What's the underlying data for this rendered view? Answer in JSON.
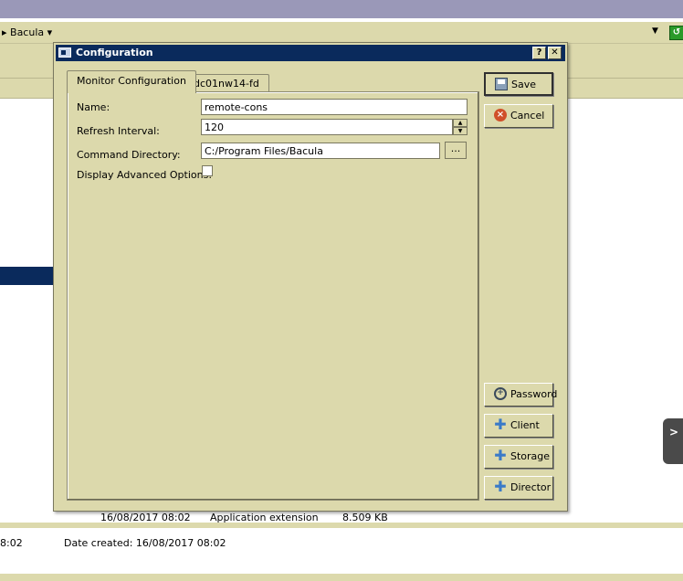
{
  "background": {
    "breadcrumb": "▸ Bacula ▾",
    "dropdown_arrow": "▼",
    "go_button": "↺",
    "file_row": {
      "date": "16/08/2017 08:02",
      "type": "Application extension",
      "size": "8.509 KB"
    },
    "details": {
      "left_time": "8:02",
      "date_created": "Date created: 16/08/2017 08:02"
    },
    "side_tab_glyph": ">"
  },
  "dialog": {
    "title": "Configuration",
    "help_glyph": "?",
    "close_glyph": "✕",
    "tabs": [
      {
        "label": "Monitor Configuration",
        "active": true
      },
      {
        "label": "dc01nw14-fd",
        "active": false
      }
    ],
    "fields": {
      "name_label": "Name:",
      "name_value": "remote-cons",
      "refresh_label": "Refresh Interval:",
      "refresh_value": "120",
      "command_label": "Command Directory:",
      "command_value": "C:/Program Files/Bacula",
      "browse_label": "...",
      "advanced_label": "Display Advanced Options:",
      "advanced_checked": false
    },
    "buttons": {
      "save": "Save",
      "cancel": "Cancel",
      "password": "Password",
      "client": "Client",
      "storage": "Storage",
      "director": "Director"
    }
  }
}
